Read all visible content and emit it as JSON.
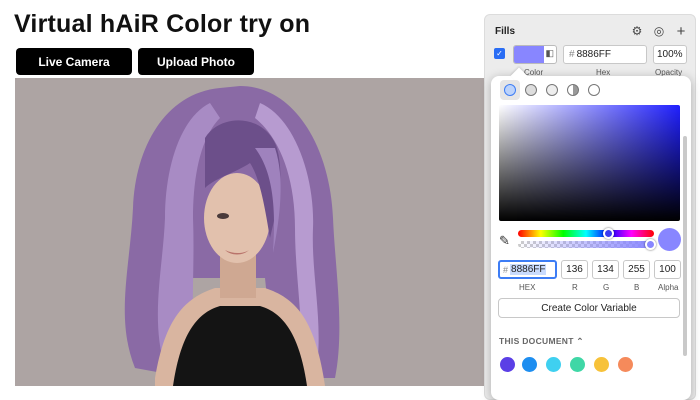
{
  "title": "Virtual hAiR Color try on",
  "buttons": {
    "live_camera": "Live Camera",
    "upload_photo": "Upload Photo"
  },
  "fills_panel": {
    "heading": "Fills",
    "hex_value": "8886FF",
    "hash": "#",
    "opacity": "100%",
    "labels": {
      "color": "Color",
      "hex": "Hex",
      "opacity": "Opacity"
    },
    "color": "#8886ff",
    "checked": true
  },
  "picker": {
    "hex": "8886FF",
    "hash": "#",
    "r": "136",
    "g": "134",
    "b": "255",
    "alpha": "100",
    "labels": {
      "hex": "HEX",
      "r": "R",
      "g": "G",
      "b": "B",
      "alpha": "Alpha"
    },
    "create_button": "Create Color Variable",
    "document_label": "THIS DOCUMENT ⌃",
    "document_swatches": [
      "#5b3fe6",
      "#1e8ef0",
      "#3fd0f0",
      "#3fd7a6",
      "#f7c23a",
      "#f58a5b"
    ]
  },
  "icons": [
    "gear-icon",
    "style-icon",
    "plus-icon",
    "eyedropper-icon",
    "checkmark-icon"
  ]
}
